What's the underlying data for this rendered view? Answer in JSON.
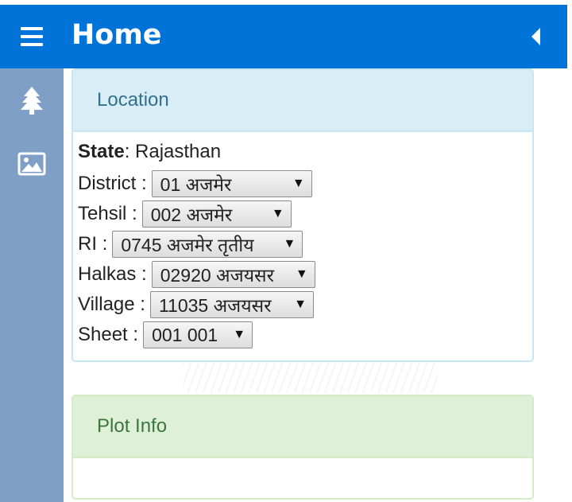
{
  "header": {
    "title": "Home",
    "menu_icon": "hamburger-menu-icon",
    "collapse_icon": "triangle-left-icon",
    "background_color": "#0073d9"
  },
  "sidebar": {
    "background_color": "#7f9fc7",
    "items": [
      {
        "icon": "tree-icon"
      },
      {
        "icon": "image-icon"
      }
    ]
  },
  "location_panel": {
    "heading": "Location",
    "state_label": "State",
    "state_value": ": Rajasthan",
    "fields": [
      {
        "label": "District :",
        "value": "01 अजमेर"
      },
      {
        "label": "Tehsil :",
        "value": "002 अजमेर"
      },
      {
        "label": "RI :",
        "value": "0745 अजमेर तृतीय"
      },
      {
        "label": "Halkas :",
        "value": "02920 अजयसर"
      },
      {
        "label": "Village :",
        "value": "11035 अजयसर"
      },
      {
        "label": "Sheet :",
        "value": "001 001"
      }
    ]
  },
  "plot_panel": {
    "heading": "Plot Info"
  }
}
